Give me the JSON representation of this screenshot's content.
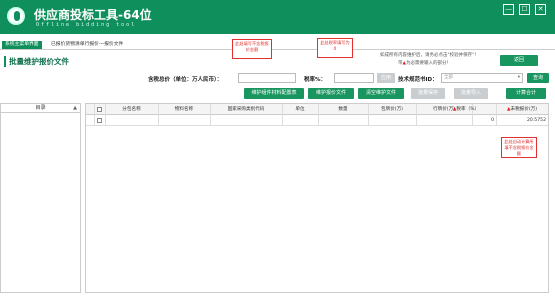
{
  "app": {
    "title": "供应商投标工具-64位",
    "subtitle": "Offline bidding tool"
  },
  "window": {
    "minimize": "—",
    "maximize": "☐",
    "close": "✕"
  },
  "tabs": [
    {
      "label": "系统主菜单界面"
    },
    {
      "label": "已报价货物清单行报价---报价文件"
    }
  ],
  "page": {
    "title": "批量维护报价文件"
  },
  "notice": {
    "line1": "如成所有内容维护后，请务必点击\"校验并保存\"！",
    "line2_prefix": "带",
    "line2_suffix": "为必需要输入的部分！"
  },
  "buttons": {
    "back": "返回",
    "apply": "应用",
    "query": "查询",
    "maintain_product_brand": "维护组件材料配置表",
    "maintain_quote_file": "维护报价文件",
    "clear_quote_file": "清空维护文件",
    "batch_save": "批量保存",
    "batch_import": "批量导入",
    "calc_total": "计算合计"
  },
  "filters": {
    "total_price_label": "含税总价（单位：万人民币）：",
    "tax_rate_label": "税率%：",
    "tech_spec_label": "技术规范书ID：",
    "tech_spec_placeholder": "全部"
  },
  "callouts": {
    "total_price": "此处填写不含税报价金额",
    "tax_rate": "此处税率填写为 0",
    "unit_price": "此处自动计算所填不含税报价金额"
  },
  "left_panel": {
    "header": "目录"
  },
  "table": {
    "columns": [
      "分包名称",
      "物料名称",
      "国家采购类别代码",
      "单位",
      "数量",
      "包牌价(万)",
      "行牌价(万)",
      "税率（%）",
      "未税报价(万)"
    ],
    "rows": [
      {
        "tax_rate": "0",
        "unit_price": "20.5752"
      }
    ]
  },
  "colors": {
    "brand": "#0f8f5c",
    "required": "#e02020"
  }
}
